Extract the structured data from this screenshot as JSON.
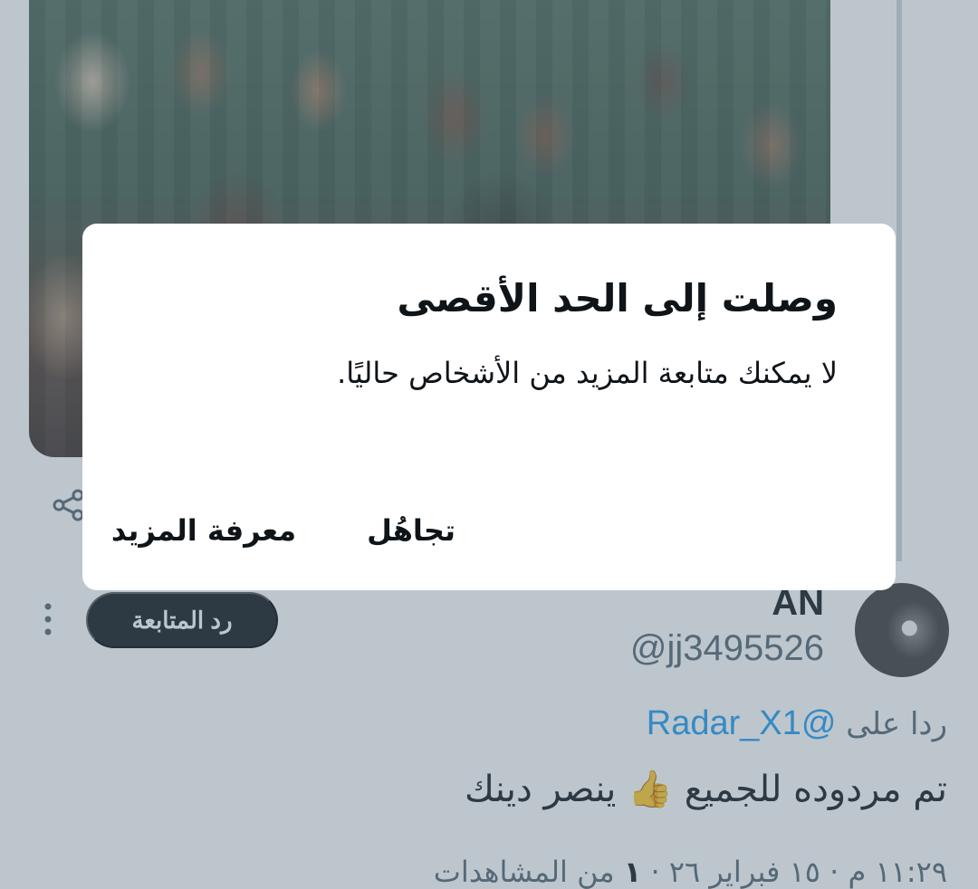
{
  "tweet": {
    "author": {
      "display_name": "AN",
      "handle": "@jj3495526"
    },
    "follow_back_label": "رد المتابعة",
    "reply_prefix": "ردا على",
    "reply_mention": "@Radar_X1",
    "text_before_emoji": "تم مردوده للجميع",
    "emoji": "👍",
    "text_after_emoji": "ينصر دينك",
    "meta_time_date": "١١:٢٩ م · ١٥ فبراير ٢٦ · ",
    "meta_views_count": "١",
    "meta_views_label": "من المشاهدات"
  },
  "dialog": {
    "title": "وصلت إلى الحد الأقصى",
    "body": "لا يمكنك متابعة المزيد من الأشخاص حاليًا.",
    "ignore_label": "تجاهُل",
    "learn_more_label": "معرفة المزيد"
  },
  "icons": {
    "share": "share-icon",
    "more": "more-vertical-icon"
  },
  "colors": {
    "scrim": "#5b7083",
    "mention": "#1d9bf0",
    "follow_button": "#0f1419",
    "secondary_text": "#536471"
  }
}
